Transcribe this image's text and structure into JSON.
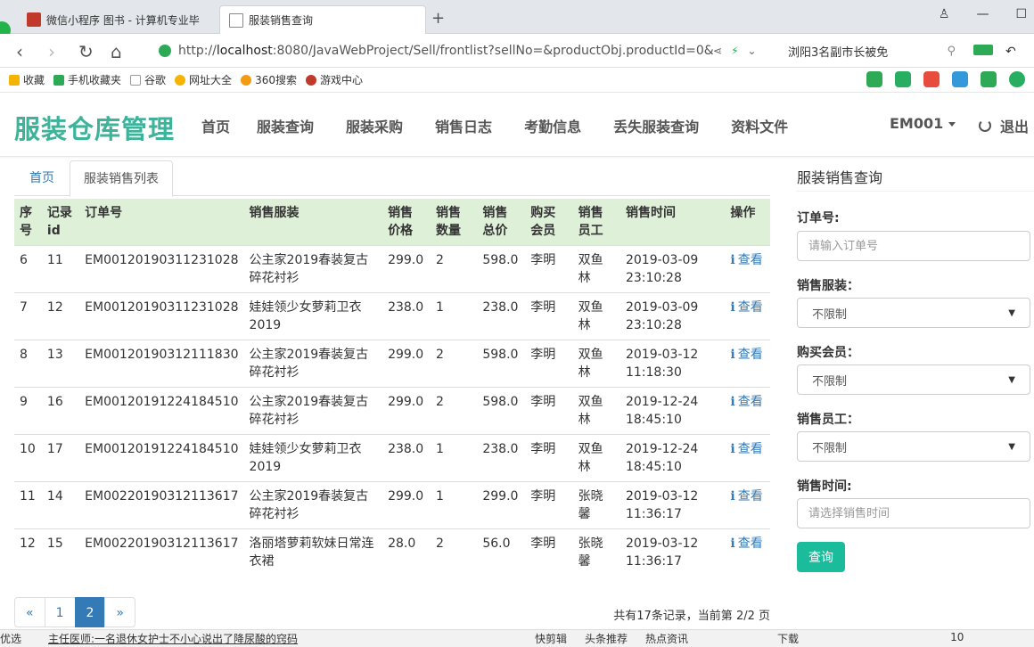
{
  "browser": {
    "tabs": [
      {
        "title": "微信小程序 图书 - 计算机专业毕",
        "active": false
      },
      {
        "title": "服装销售查询",
        "active": true
      }
    ],
    "url_prefix": "http://",
    "url_host": "localhost",
    "url_rest": ":8080/JavaWebProject/Sell/frontlist?sellNo=&productObj.productId=0&",
    "search_text": "浏阳3名副市长被免",
    "bookmarks": [
      "收藏",
      "手机收藏夹",
      "谷歌",
      "网址大全",
      "360搜索",
      "游戏中心"
    ]
  },
  "site": {
    "brand": "服装仓库管理",
    "nav": [
      "首页",
      "服装查询",
      "服装采购",
      "销售日志",
      "考勤信息",
      "丢失服装查询",
      "资料文件"
    ],
    "user": "EM001",
    "logout": "退出"
  },
  "content_tabs": [
    "首页",
    "服装销售列表"
  ],
  "table": {
    "headers": [
      "序号",
      "记录id",
      "订单号",
      "销售服装",
      "销售价格",
      "销售数量",
      "销售总价",
      "购买会员",
      "销售员工",
      "销售时间",
      "操作"
    ],
    "rows": [
      {
        "no": "6",
        "id": "11",
        "order": "EM00120190311231028",
        "product": "公主家2019春装复古碎花衬衫",
        "price": "299.0",
        "qty": "2",
        "total": "598.0",
        "member": "李明",
        "staff": "双鱼林",
        "time": "2019-03-09 23:10:28",
        "action": "查看"
      },
      {
        "no": "7",
        "id": "12",
        "order": "EM00120190311231028",
        "product": "娃娃领少女萝莉卫衣2019",
        "price": "238.0",
        "qty": "1",
        "total": "238.0",
        "member": "李明",
        "staff": "双鱼林",
        "time": "2019-03-09 23:10:28",
        "action": "查看"
      },
      {
        "no": "8",
        "id": "13",
        "order": "EM00120190312111830",
        "product": "公主家2019春装复古碎花衬衫",
        "price": "299.0",
        "qty": "2",
        "total": "598.0",
        "member": "李明",
        "staff": "双鱼林",
        "time": "2019-03-12 11:18:30",
        "action": "查看"
      },
      {
        "no": "9",
        "id": "16",
        "order": "EM00120191224184510",
        "product": "公主家2019春装复古碎花衬衫",
        "price": "299.0",
        "qty": "2",
        "total": "598.0",
        "member": "李明",
        "staff": "双鱼林",
        "time": "2019-12-24 18:45:10",
        "action": "查看"
      },
      {
        "no": "10",
        "id": "17",
        "order": "EM00120191224184510",
        "product": "娃娃领少女萝莉卫衣2019",
        "price": "238.0",
        "qty": "1",
        "total": "238.0",
        "member": "李明",
        "staff": "双鱼林",
        "time": "2019-12-24 18:45:10",
        "action": "查看"
      },
      {
        "no": "11",
        "id": "14",
        "order": "EM00220190312113617",
        "product": "公主家2019春装复古碎花衬衫",
        "price": "299.0",
        "qty": "1",
        "total": "299.0",
        "member": "李明",
        "staff": "张晓馨",
        "time": "2019-03-12 11:36:17",
        "action": "查看"
      },
      {
        "no": "12",
        "id": "15",
        "order": "EM00220190312113617",
        "product": "洛丽塔萝莉软妹日常连衣裙",
        "price": "28.0",
        "qty": "2",
        "total": "56.0",
        "member": "李明",
        "staff": "张晓馨",
        "time": "2019-03-12 11:36:17",
        "action": "查看"
      }
    ]
  },
  "pagination": {
    "prev": "«",
    "pages": [
      "1",
      "2"
    ],
    "current": "2",
    "next": "»",
    "summary": "共有17条记录，当前第 2/2 页"
  },
  "search": {
    "title": "服装销售查询",
    "order_label": "订单号:",
    "order_placeholder": "请输入订单号",
    "product_label": "销售服装：",
    "product_value": "不限制",
    "member_label": "购买会员：",
    "member_value": "不限制",
    "staff_label": "销售员工：",
    "staff_value": "不限制",
    "time_label": "销售时间:",
    "time_placeholder": "请选择销售时间",
    "button": "查询"
  },
  "statusbar": {
    "left": "优选",
    "news": "主任医师:一名退休女护士不小心说出了降尿酸的窍码",
    "items": [
      "快剪辑",
      "头条推荐",
      "热点资讯",
      "下载"
    ],
    "zoom": "10"
  },
  "colors": {
    "brand": "#3eb39a",
    "header_row": "#dff0d8",
    "link": "#337ab7",
    "button": "#1abc9c"
  }
}
